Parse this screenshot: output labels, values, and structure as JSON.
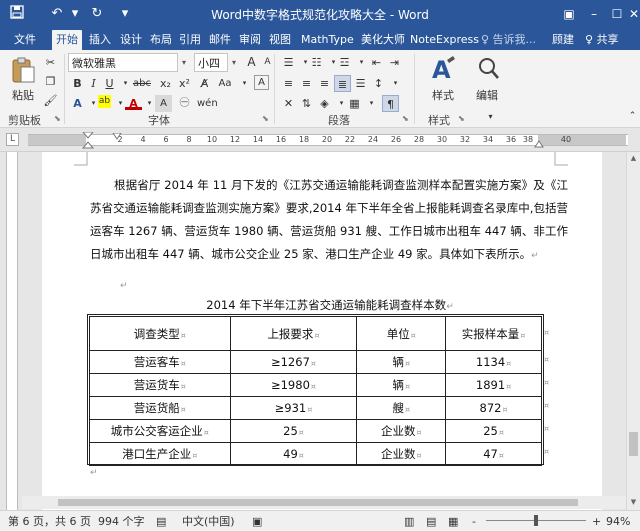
{
  "window": {
    "title": "Word中数字格式规范化攻略大全 - Word",
    "quick_access": {
      "save_icon": "save-icon",
      "undo_icon": "undo-icon",
      "redo_icon": "redo-icon"
    }
  },
  "ribbon_tabs": [
    "文件",
    "开始",
    "插入",
    "设计",
    "布局",
    "引用",
    "邮件",
    "审阅",
    "视图",
    "MathType",
    "美化大师",
    "NoteExpress"
  ],
  "active_tab": "开始",
  "tell_me": "♀ 告诉我...",
  "account": "顾建",
  "share": "♀ 共享",
  "clipboard": {
    "paste_label": "粘贴",
    "group_label": "剪贴板"
  },
  "font": {
    "name": "微软雅黑",
    "size": "小四",
    "group_label": "字体",
    "abc": "abc",
    "x2_sub": "x₂",
    "x2_sup": "x²",
    "aa": "Aa",
    "grow": "A",
    "shrink": "A",
    "underline_label": "U"
  },
  "paragraph": {
    "group_label": "段落"
  },
  "styles": {
    "label": "样式",
    "group_label": "样式"
  },
  "editing": {
    "label": "编辑"
  },
  "ruler": {
    "box_label": "L",
    "numbers": [
      "2",
      "4",
      "6",
      "8",
      "10",
      "12",
      "14",
      "16",
      "18",
      "20",
      "22",
      "24",
      "26",
      "28",
      "30",
      "32",
      "34",
      "36",
      "38",
      "40"
    ]
  },
  "document": {
    "paragraph": "根据省厅 2014 年 11 月下发的《江苏交通运输能耗调查监测样本配置实施方案》及《江苏省交通运输能耗调查监测实施方案》要求,2014 年下半年全省上报能耗调查名录库中,包括营运客车 1267 辆、营运货车 1980 辆、营运货船 931 艘、工作日城市出租车 447 辆、非工作日城市出租车 447 辆、城市公交企业 25 家、港口生产企业 49 家。具体如下表所示。",
    "para_mark": "↵",
    "caption": "2014 年下半年江苏省交通运输能耗调查样本数",
    "table": {
      "headers": [
        "调查类型",
        "上报要求",
        "单位",
        "实报样本量"
      ],
      "rows": [
        [
          "营运客车",
          "≥1267",
          "辆",
          "1134"
        ],
        [
          "营运货车",
          "≥1980",
          "辆",
          "1891"
        ],
        [
          "营运货船",
          "≥931",
          "艘",
          "872"
        ],
        [
          "城市公交客运企业",
          "25",
          "企业数",
          "25"
        ],
        [
          "港口生产企业",
          "49",
          "企业数",
          "47"
        ]
      ]
    }
  },
  "status": {
    "page": "第 6 页，共 6 页",
    "words": "994 个字",
    "language": "中文(中国)",
    "zoom": "94%",
    "zoom_minus": "-",
    "zoom_plus": "+"
  }
}
